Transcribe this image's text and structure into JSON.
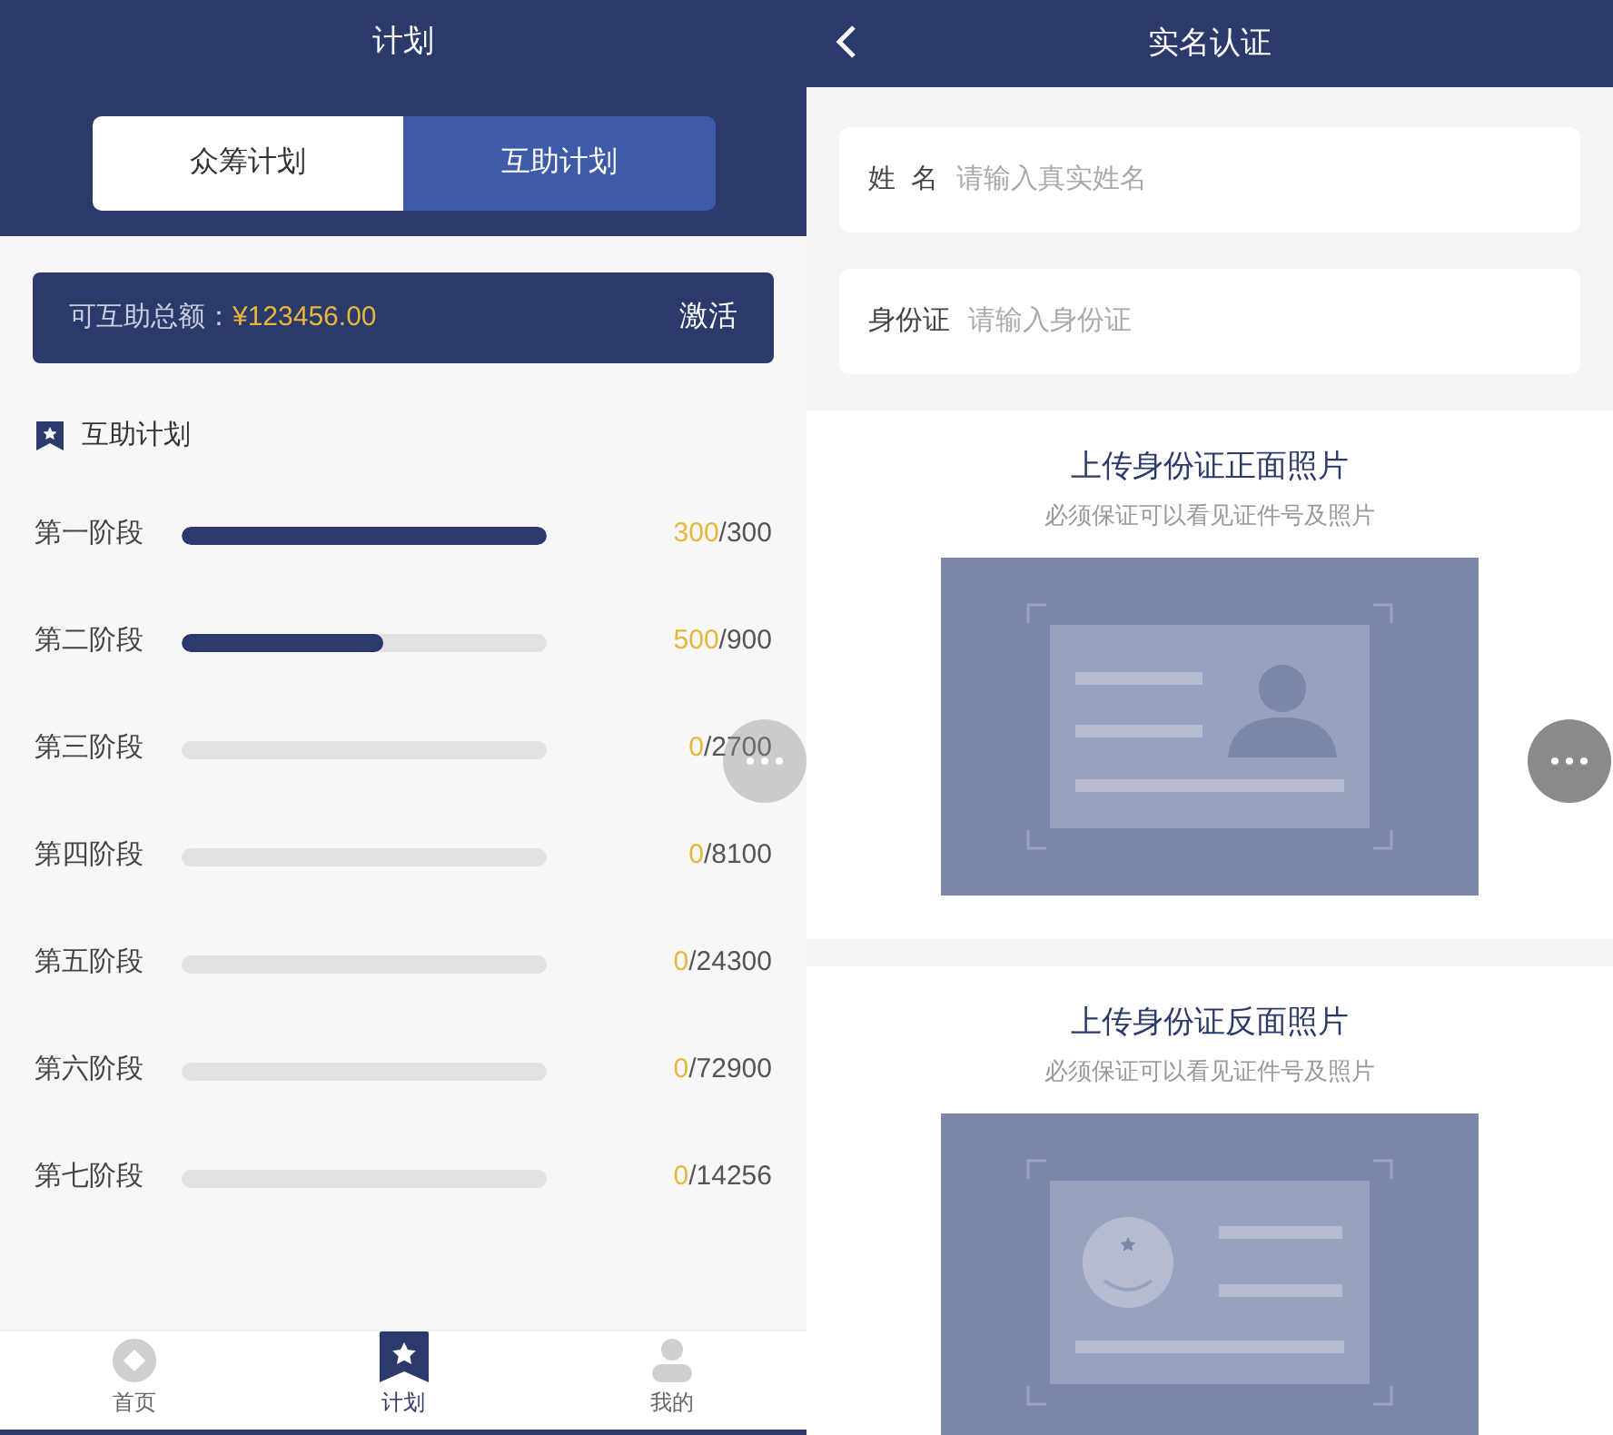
{
  "plan_screen": {
    "title": "计划",
    "tabs": [
      {
        "label": "众筹计划",
        "selected": false
      },
      {
        "label": "互助计划",
        "selected": true
      }
    ],
    "balance": {
      "label": "可互助总额：",
      "amount": "¥123456.00",
      "action": "激活"
    },
    "section_title": "互助计划",
    "stages": [
      {
        "name": "第一阶段",
        "level": 1.0,
        "done": "300",
        "total": "/300"
      },
      {
        "name": "第二阶段",
        "level": 0.55,
        "done": "500",
        "total": "/900"
      },
      {
        "name": "第三阶段",
        "level": 0,
        "done": "0",
        "total": "/2700"
      },
      {
        "name": "第四阶段",
        "level": 0,
        "done": "0",
        "total": "/8100"
      },
      {
        "name": "第五阶段",
        "level": 0,
        "done": "0",
        "total": "/24300"
      },
      {
        "name": "第六阶段",
        "level": 0,
        "done": "0",
        "total": "/72900"
      },
      {
        "name": "第七阶段",
        "level": 0,
        "done": "0",
        "total": "/14256"
      }
    ],
    "nav": [
      {
        "label": "首页",
        "kind": "home",
        "selected": false
      },
      {
        "label": "计划",
        "kind": "plan",
        "selected": true
      },
      {
        "label": "我的",
        "kind": "profile",
        "selected": false
      }
    ]
  },
  "verify_screen": {
    "title": "实名认证",
    "fields": [
      {
        "label": "姓  名",
        "placeholder": "请输入真实姓名"
      },
      {
        "label": "身份证",
        "placeholder": "请输入身份证"
      }
    ],
    "uploads": [
      {
        "title": "上传身份证正面照片",
        "hint": "必须保证可以看见证件号及照片",
        "kind": "front"
      },
      {
        "title": "上传身份证反面照片",
        "hint": "必须保证可以看见证件号及照片",
        "kind": "back"
      }
    ]
  }
}
